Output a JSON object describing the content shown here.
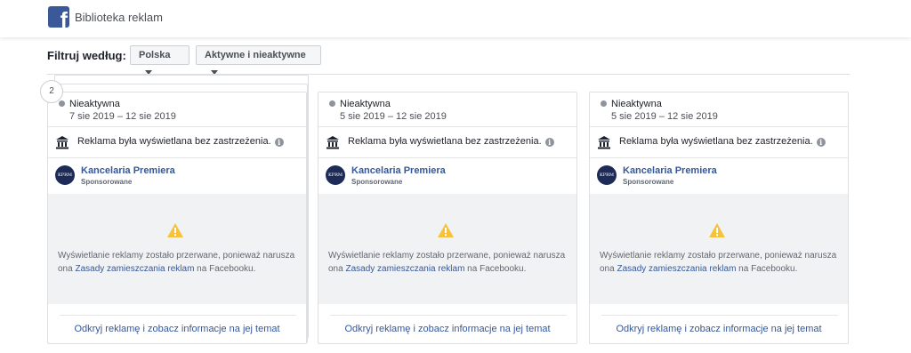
{
  "header": {
    "brand_name": "Biblioteka reklam",
    "logo_glyph": "f",
    "logo_icon": "facebook-logo-icon"
  },
  "filters": {
    "label": "Filtruj według:",
    "country": "Polska",
    "status": "Aktywne i nieaktywne"
  },
  "stack_count": "2",
  "cards": [
    {
      "status": "Nieaktywna",
      "dates": "7 sie 2019 – 12 sie 2019",
      "shown_note": "Reklama była wyświetlana bez zastrzeżenia.",
      "page_name": "Kancelaria Premiera",
      "sponsored": "Sponsorowane",
      "avatar_text": "KPRM",
      "violation_pre": "Wyświetlanie reklamy zostało przerwane, ponieważ narusza ona ",
      "violation_link": "Zasady zamieszczania reklam",
      "violation_post": " na Facebooku.",
      "open_link": "Odkryj reklamę i zobacz informacje na jej temat"
    },
    {
      "status": "Nieaktywna",
      "dates": "5 sie 2019 – 12 sie 2019",
      "shown_note": "Reklama była wyświetlana bez zastrzeżenia.",
      "page_name": "Kancelaria Premiera",
      "sponsored": "Sponsorowane",
      "avatar_text": "KPRM",
      "violation_pre": "Wyświetlanie reklamy zostało przerwane, ponieważ narusza ona ",
      "violation_link": "Zasady zamieszczania reklam",
      "violation_post": " na Facebooku.",
      "open_link": "Odkryj reklamę i zobacz informacje na jej temat"
    },
    {
      "status": "Nieaktywna",
      "dates": "5 sie 2019 – 12 sie 2019",
      "shown_note": "Reklama była wyświetlana bez zastrzeżenia.",
      "page_name": "Kancelaria Premiera",
      "sponsored": "Sponsorowane",
      "avatar_text": "KPRM",
      "violation_pre": "Wyświetlanie reklamy zostało przerwane, ponieważ narusza ona ",
      "violation_link": "Zasady zamieszczania reklam",
      "violation_post": " na Facebooku.",
      "open_link": "Odkryj reklamę i zobacz informacje na jej temat"
    }
  ],
  "icons": {
    "info": "i",
    "status": "status-dot-icon",
    "bank": "bank-icon",
    "warning": "warning-icon"
  },
  "colors": {
    "facebook_blue": "#3b5998",
    "link": "#365899",
    "warning": "#f5c33b"
  }
}
